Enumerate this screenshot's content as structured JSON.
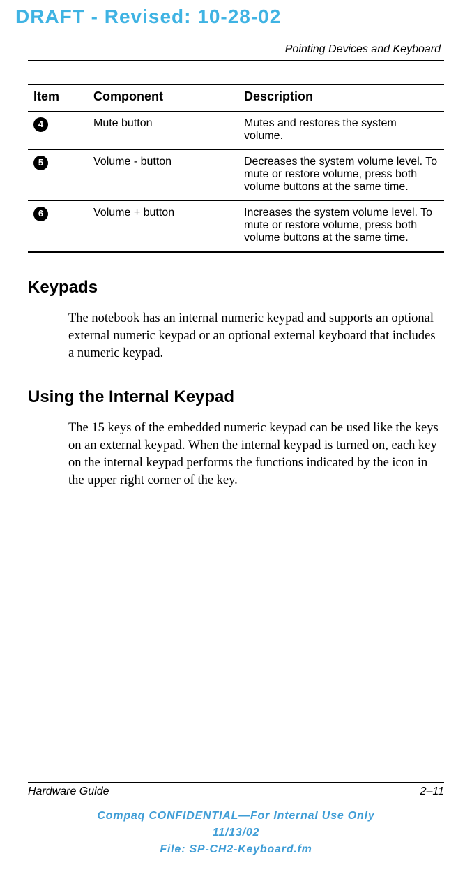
{
  "draft_banner": "DRAFT - Revised: 10-28-02",
  "chapter_title": "Pointing Devices and Keyboard",
  "table": {
    "headers": {
      "item": "Item",
      "component": "Component",
      "description": "Description"
    },
    "rows": [
      {
        "item": "4",
        "component": "Mute button",
        "description": "Mutes and restores the system volume."
      },
      {
        "item": "5",
        "component": "Volume - button",
        "description": "Decreases the system volume level. To mute or restore volume, press both volume buttons at the same time."
      },
      {
        "item": "6",
        "component": "Volume + button",
        "description": "Increases the system volume level. To mute or restore volume, press both volume buttons at the same time."
      }
    ]
  },
  "sections": {
    "keypads_heading": "Keypads",
    "keypads_body": "The notebook has an internal numeric keypad and supports an optional external numeric keypad or an optional external keyboard that includes a numeric keypad.",
    "using_heading": "Using the Internal Keypad",
    "using_body": "The 15 keys of the embedded numeric keypad can be used like the keys on an external keypad. When the internal keypad is turned on, each key on the internal keypad performs the functions indicated by the icon in the upper right corner of the key."
  },
  "footer": {
    "guide": "Hardware Guide",
    "page": "2–11",
    "conf_line1": "Compaq CONFIDENTIAL—For Internal Use Only",
    "conf_line2": "11/13/02",
    "conf_line3": "File: SP-CH2-Keyboard.fm"
  }
}
